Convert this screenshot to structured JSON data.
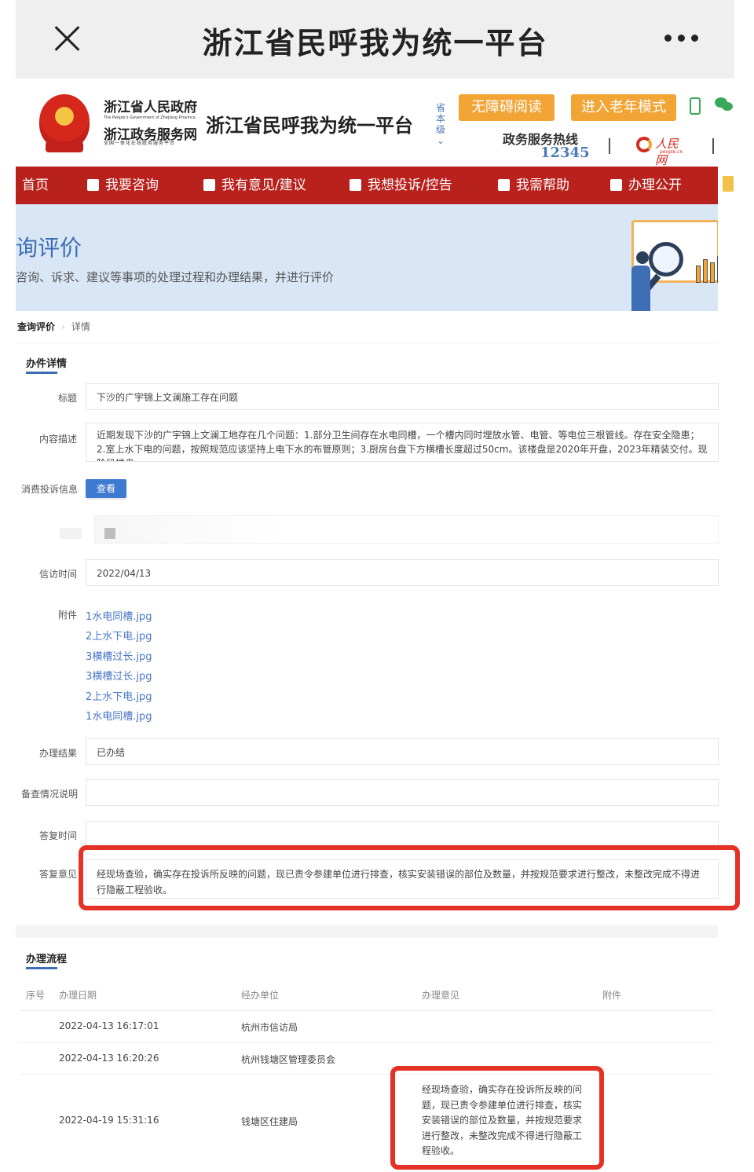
{
  "appbar": {
    "title": "浙江省民呼我为统一平台",
    "close_icon": "close-icon",
    "more_icon": "more-icon"
  },
  "header": {
    "gov_name": "浙江省人民政府",
    "gov_name_en": "The People's Government of Zhejiang Province",
    "service_name": "浙江政务服务网",
    "service_sub": "全国一体化在线政务服务平台",
    "platform_title": "浙江省民呼我为统一平台",
    "level": "省本级",
    "accessibility_btn": "无障碍阅读",
    "elder_mode_btn": "进入老年模式",
    "hotline_label": "政务服务热线",
    "hotline_number": "12345",
    "people_logo": "人民网",
    "people_domain": "people.cn",
    "accent_color": "#b8211c",
    "button_color": "#f2a535"
  },
  "nav": {
    "items": [
      {
        "label": "首页",
        "icon": "home-icon"
      },
      {
        "label": "我要咨询",
        "icon": "question-icon"
      },
      {
        "label": "我有意见/建议",
        "icon": "edit-icon"
      },
      {
        "label": "我想投诉/控告",
        "icon": "complaint-icon"
      },
      {
        "label": "我需帮助",
        "icon": "book-icon"
      },
      {
        "label": "办理公开",
        "icon": "document-icon"
      }
    ]
  },
  "banner": {
    "title": "查询评价",
    "description": "查询咨询、诉求、建议等事项的处理过程和办理结果，并进行评价"
  },
  "breadcrumb": {
    "current": "查询评价",
    "detail": "详情"
  },
  "detail": {
    "section_title": "办件详情",
    "title_label": "标题",
    "title_value": "下沙的广宇锦上文澜施工存在问题",
    "content_label": "内容描述",
    "content_value": "近期发现下沙的广宇锦上文澜工地存在几个问题：1.部分卫生间存在水电同槽，一个槽内同时埋放水管、电管、等电位三根管线。存在安全隐患；2.室上水下电的问题，按照规范应该坚持上电下水的布管原则；3.厨房台盘下方横槽长度超过50cm。该楼盘是2020年开盘，2023年精装交付。现阶段楼盘",
    "consumer_label": "消费投诉信息",
    "view_btn": "查看",
    "visit_time_label": "信访时间",
    "visit_time_value": "2022/04/13",
    "attachments_label": "附件",
    "attachments": [
      "1水电同槽.jpg",
      "2上水下电.jpg",
      "3横槽过长.jpg",
      "3横槽过长.jpg",
      "2上水下电.jpg",
      "1水电同槽.jpg"
    ],
    "result_label": "办理结果",
    "result_value": "已办结",
    "filing_label": "备查情况说明",
    "filing_value": "",
    "reply_time_label": "答复时间",
    "reply_time_value": "",
    "reply_label": "答复意见",
    "reply_value": "经现场查验，确实存在投诉所反映的问题，现已责令参建单位进行排查，核实安装错误的部位及数量，并按规范要求进行整改，未整改完成不得进行隐蔽工程验收。"
  },
  "process": {
    "section_title": "办理流程",
    "columns": [
      "序号",
      "办理日期",
      "经办单位",
      "办理意见",
      "附件"
    ],
    "rows": [
      {
        "date": "2022-04-13 16:17:01",
        "unit": "杭州市信访局",
        "opinion": ""
      },
      {
        "date": "2022-04-13 16:20:26",
        "unit": "杭州钱塘区管理委员会",
        "opinion": ""
      },
      {
        "date": "2022-04-19 15:31:16",
        "unit": "钱塘区住建局",
        "opinion": "经现场查验，确实存在投诉所反映的问题，现已责令参建单位进行排查，核实安装错误的部位及数量，并按规范要求进行整改，未整改完成不得进行隐蔽工程验收。"
      }
    ]
  },
  "highlight_color": "#e43326"
}
